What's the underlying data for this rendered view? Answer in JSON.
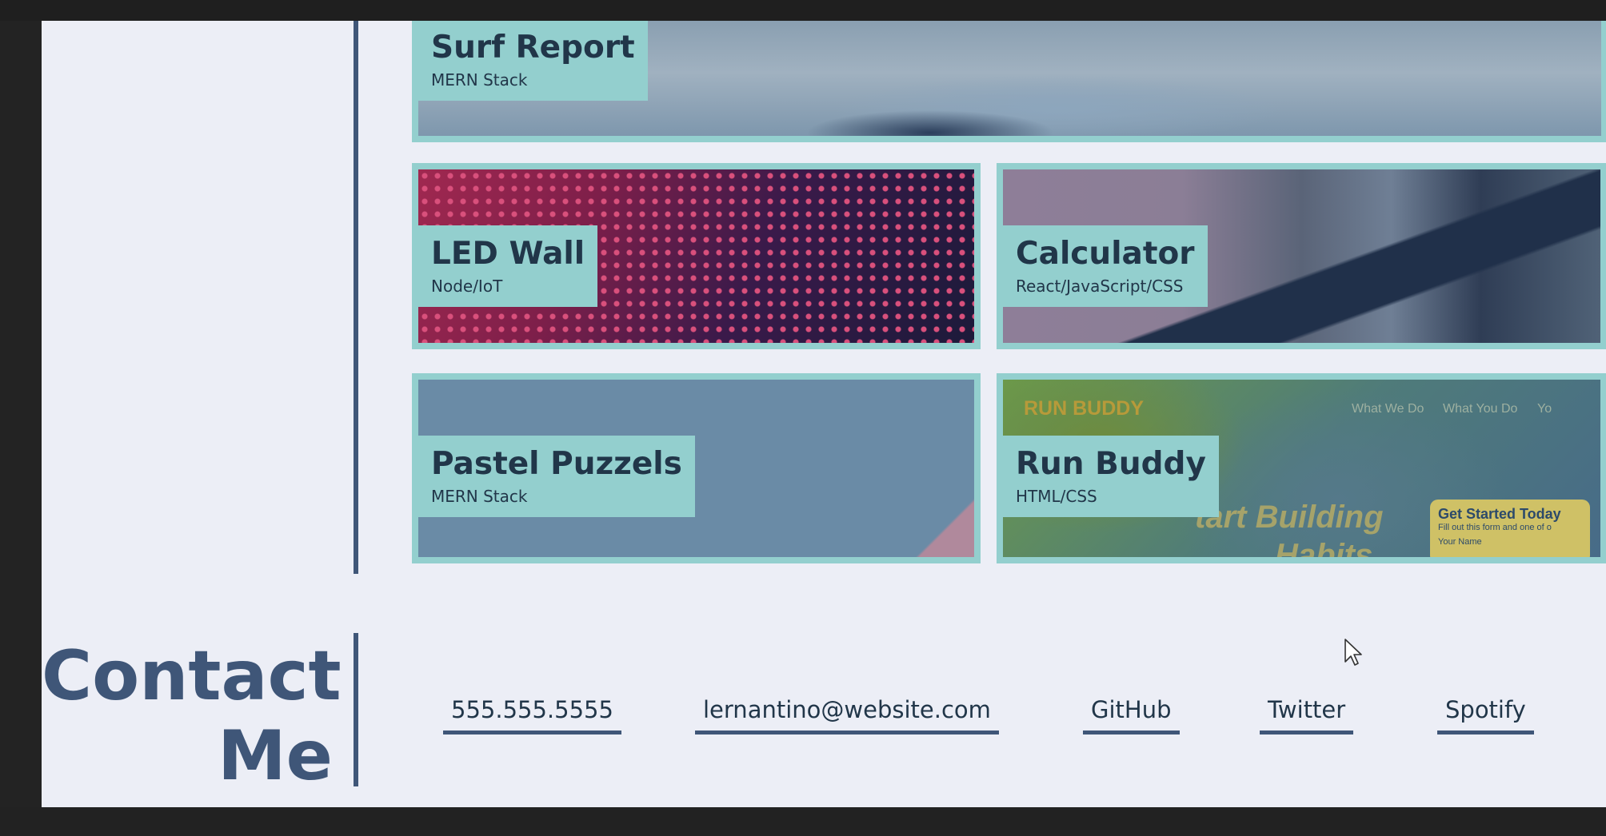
{
  "projects": [
    {
      "id": "surf",
      "title": "Surf Report",
      "tech": "MERN Stack"
    },
    {
      "id": "led",
      "title": "LED Wall",
      "tech": "Node/IoT"
    },
    {
      "id": "calc",
      "title": "Calculator",
      "tech": "React/JavaScript/CSS"
    },
    {
      "id": "puzzle",
      "title": "Pastel Puzzels",
      "tech": "MERN Stack"
    },
    {
      "id": "run",
      "title": "Run Buddy",
      "tech": "HTML/CSS"
    }
  ],
  "run_buddy_preview": {
    "brand": "RUN BUDDY",
    "nav": [
      "What We Do",
      "What You Do",
      "Yo"
    ],
    "headline_1": "tart Building",
    "headline_2": "Habits",
    "form_title": "Get Started Today",
    "form_sub": "Fill out this form and one of o",
    "form_field": "Your Name"
  },
  "contact": {
    "heading_line1": "Contact",
    "heading_line2": "Me",
    "links": [
      "555.555.5555",
      "lernantino@website.com",
      "GitHub",
      "Twitter",
      "Spotify"
    ]
  },
  "colors": {
    "accent": "#93cfce",
    "primary": "#3f5678",
    "text": "#213649",
    "page_bg": "#eceef6"
  }
}
